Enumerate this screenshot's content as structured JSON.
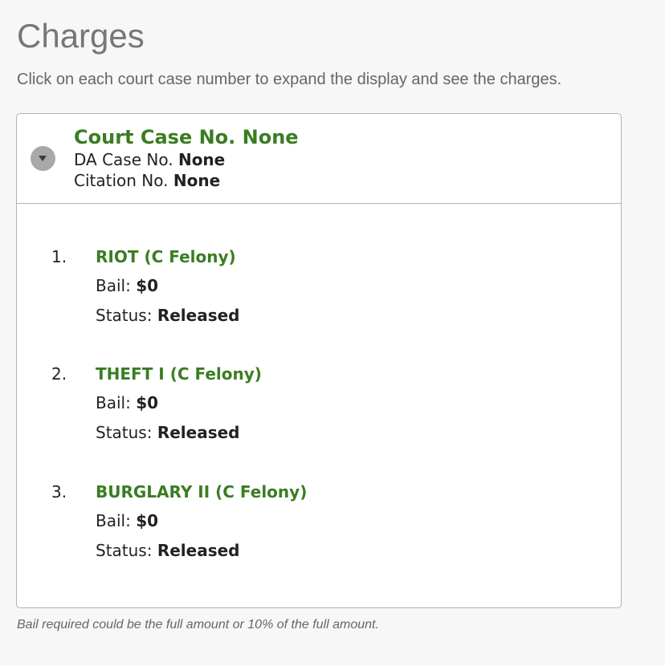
{
  "page": {
    "title": "Charges",
    "instructions": "Click on each court case number to expand the display and see the charges.",
    "footnote": "Bail required could be the full amount or 10% of the full amount."
  },
  "case": {
    "court_case_label": "Court Case No.",
    "court_case_value": "None",
    "da_case_label": "DA Case No.",
    "da_case_value": "None",
    "citation_label": "Citation No.",
    "citation_value": "None",
    "toggle_icon": "chevron-down-icon",
    "expanded": true
  },
  "charges": [
    {
      "number": "1.",
      "name": "RIOT (C Felony)",
      "bail_label": "Bail:",
      "bail": "$0",
      "status_label": "Status:",
      "status": "Released"
    },
    {
      "number": "2.",
      "name": "THEFT I (C Felony)",
      "bail_label": "Bail:",
      "bail": "$0",
      "status_label": "Status:",
      "status": "Released"
    },
    {
      "number": "3.",
      "name": "BURGLARY II (C Felony)",
      "bail_label": "Bail:",
      "bail": "$0",
      "status_label": "Status:",
      "status": "Released"
    }
  ],
  "colors": {
    "accent_green": "#3a7d22",
    "title_gray": "#777777",
    "border_gray": "#b3b3b3",
    "toggle_gray": "#a8a8a8"
  }
}
